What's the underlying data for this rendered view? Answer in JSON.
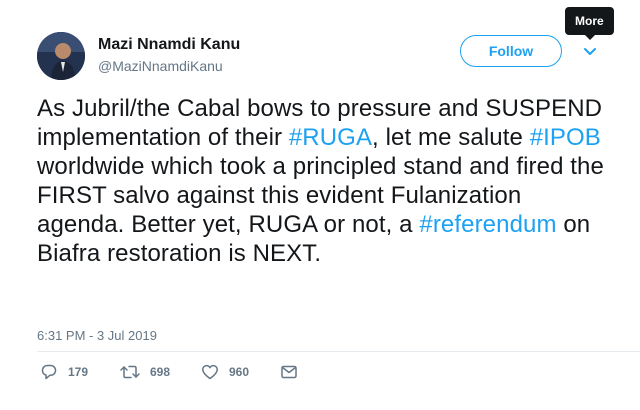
{
  "user": {
    "display_name": "Mazi Nnamdi Kanu",
    "handle": "@MaziNnamdiKanu"
  },
  "follow_button": {
    "label": "Follow"
  },
  "more_tooltip": {
    "label": "More"
  },
  "tweet": {
    "segments": [
      {
        "text": "As Jubril/the Cabal bows to pressure and SUSPEND implementation of their ",
        "hashtag": false
      },
      {
        "text": "#RUGA",
        "hashtag": true
      },
      {
        "text": ", let me salute ",
        "hashtag": false
      },
      {
        "text": "#IPOB",
        "hashtag": true
      },
      {
        "text": " worldwide which took a principled stand and fired the FIRST salvo against this evident Fulanization agenda. Better yet, RUGA or not, a ",
        "hashtag": false
      },
      {
        "text": "#referendum",
        "hashtag": true
      },
      {
        "text": " on Biafra restoration is NEXT.",
        "hashtag": false
      }
    ],
    "timestamp": "6:31 PM - 3 Jul 2019"
  },
  "actions": {
    "replies": "179",
    "retweets": "698",
    "likes": "960"
  },
  "colors": {
    "accent": "#1da1f2",
    "text": "#14171a",
    "secondary": "#657786",
    "divider": "#e6ecf0",
    "tooltip_bg": "#14171a"
  },
  "icons": {
    "reply": "reply-icon",
    "retweet": "retweet-icon",
    "like": "heart-icon",
    "dm": "envelope-icon",
    "more": "chevron-down-icon"
  }
}
